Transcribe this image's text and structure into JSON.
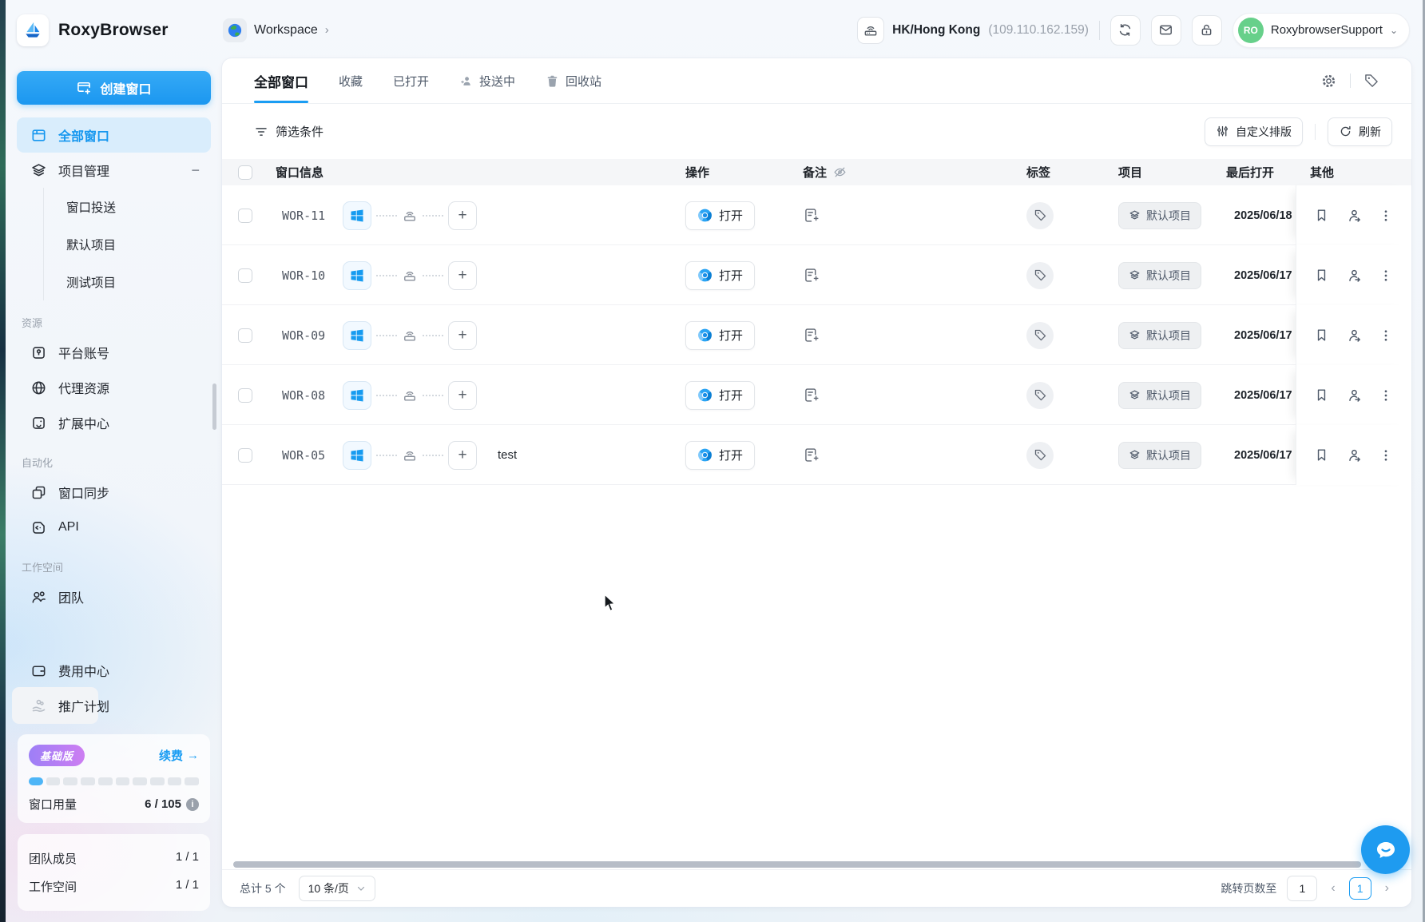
{
  "app": {
    "name": "RoxyBrowser"
  },
  "header": {
    "workspace_label": "Workspace",
    "proxy_location": "HK/Hong Kong",
    "proxy_ip": "(109.110.162.159)",
    "user_initials": "RO",
    "user_name": "RoxybrowserSupport"
  },
  "sidebar": {
    "create_window_label": "创建窗口",
    "all_windows_label": "全部窗口",
    "project_mgmt_label": "项目管理",
    "project_children": [
      "窗口投送",
      "默认项目",
      "测试项目"
    ],
    "section_resources": "资源",
    "resources": [
      "平台账号",
      "代理资源",
      "扩展中心"
    ],
    "section_automation": "自动化",
    "automation": [
      "窗口同步",
      "API"
    ],
    "section_workspace": "工作空间",
    "team_label": "团队",
    "billing_label": "费用中心",
    "promotion_label": "推广计划",
    "plan": {
      "badge": "基础版",
      "renew_label": "续费",
      "renew_arrow": "→",
      "usage_label": "窗口用量",
      "usage_value": "6 / 105",
      "segments_total": 10,
      "segments_filled": 1
    },
    "stats": [
      {
        "label": "团队成员",
        "value": "1 / 1"
      },
      {
        "label": "工作空间",
        "value": "1 / 1"
      }
    ]
  },
  "main": {
    "tabs": [
      {
        "label": "全部窗口"
      },
      {
        "label": "收藏"
      },
      {
        "label": "已打开"
      },
      {
        "label": "投送中"
      },
      {
        "label": "回收站"
      }
    ],
    "filter_label": "筛选条件",
    "custom_layout_label": "自定义排版",
    "refresh_label": "刷新",
    "table": {
      "columns": {
        "info": "窗口信息",
        "action": "操作",
        "note": "备注",
        "tag": "标签",
        "project": "项目",
        "last_open": "最后打开",
        "other": "其他"
      },
      "rows": [
        {
          "id": "WOR-11",
          "name": "",
          "open": "打开",
          "project": "默认项目",
          "date": "2025/06/18"
        },
        {
          "id": "WOR-10",
          "name": "",
          "open": "打开",
          "project": "默认项目",
          "date": "2025/06/17"
        },
        {
          "id": "WOR-09",
          "name": "",
          "open": "打开",
          "project": "默认项目",
          "date": "2025/06/17"
        },
        {
          "id": "WOR-08",
          "name": "",
          "open": "打开",
          "project": "默认项目",
          "date": "2025/06/17"
        },
        {
          "id": "WOR-05",
          "name": "test",
          "open": "打开",
          "project": "默认项目",
          "date": "2025/06/17"
        }
      ]
    },
    "footer": {
      "total": "总计 5 个",
      "page_size": "10 条/页",
      "jump_label": "跳转页数至",
      "jump_value": "1",
      "current_page": "1"
    }
  },
  "colors": {
    "primary": "#1b9df3",
    "active_item_bg": "#d9edfc",
    "avatar_green": "#67d08a",
    "plan_badge_gradient": [
      "#9d7ff6",
      "#cd7ef2"
    ]
  }
}
